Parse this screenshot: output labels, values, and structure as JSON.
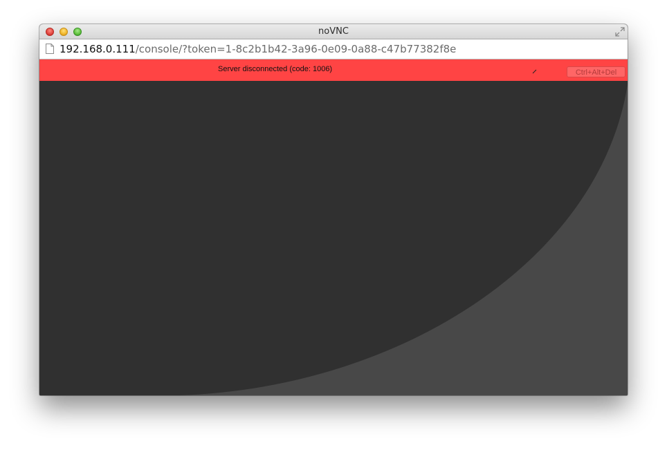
{
  "window": {
    "title": "noVNC"
  },
  "address_bar": {
    "host": "192.168.0.111",
    "path": "/console/?token=1-8c2b1b42-3a96-0e09-0a88-c47b77382f8e"
  },
  "novnc": {
    "status_message": "Server disconnected (code: 1006)",
    "status_color": "#ff4444",
    "ctrl_alt_del_label": "Ctrl+Alt+Del"
  },
  "colors": {
    "canvas_dark": "#303030",
    "canvas_light": "#484848"
  }
}
